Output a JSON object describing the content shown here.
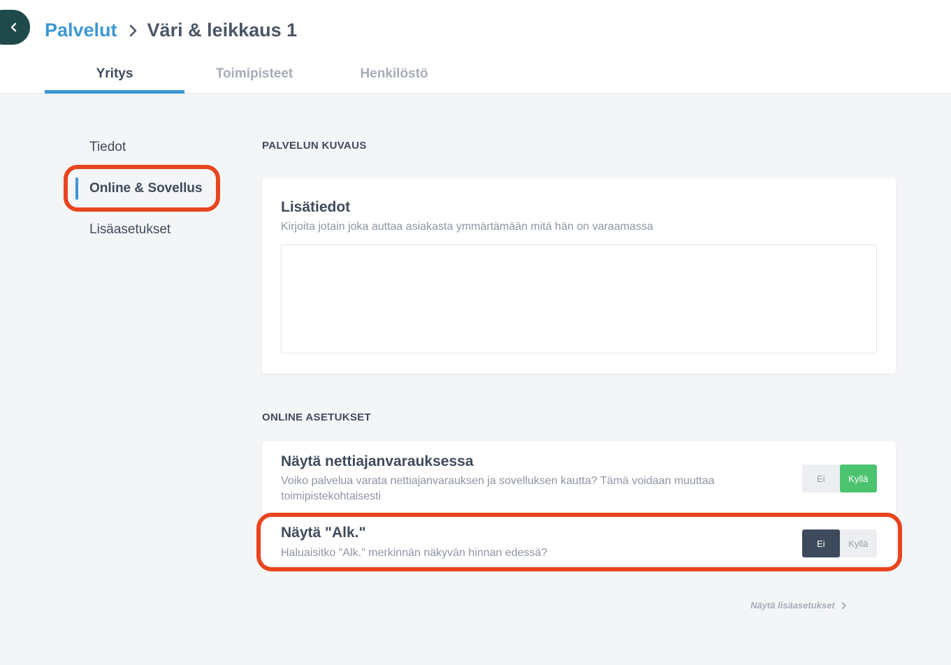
{
  "breadcrumb": {
    "parent": "Palvelut",
    "current": "Väri & leikkaus 1"
  },
  "tabs": [
    {
      "label": "Yritys",
      "active": true
    },
    {
      "label": "Toimipisteet",
      "active": false
    },
    {
      "label": "Henkilöstö",
      "active": false
    }
  ],
  "sidenav": {
    "items": [
      {
        "label": "Tiedot",
        "active": false
      },
      {
        "label": "Online & Sovellus",
        "active": true
      },
      {
        "label": "Lisäasetukset",
        "active": false
      }
    ]
  },
  "description_section": {
    "title": "PALVELUN KUVAUS",
    "field_title": "Lisätiedot",
    "field_help": "Kirjoita jotain joka auttaa asiakasta ymmärtämään mitä hän on varaamassa",
    "value": ""
  },
  "online_section": {
    "title": "ONLINE ASETUKSET",
    "settings": [
      {
        "title": "Näytä nettiajanvarauksessa",
        "help": "Voiko palvelua varata nettiajanvarauksen ja sovelluksen kautta? Tämä voidaan muuttaa toimipistekohtaisesti",
        "no_label": "Ei",
        "yes_label": "Kyllä",
        "selected": "Kyllä"
      },
      {
        "title": "Näytä \"Alk.\"",
        "help": "Haluaisitko \"Alk.\" merkinnän näkyvän hinnan edessä?",
        "no_label": "Ei",
        "yes_label": "Kyllä",
        "selected": "Ei"
      }
    ]
  },
  "more_settings_label": "Näytä lisäasetukset",
  "colors": {
    "accent": "#3c97d3",
    "highlight": "#e8451f",
    "toggle_yes": "#4cc46f",
    "toggle_no": "#3d4a5c",
    "back_button": "#1f4a4c"
  },
  "icons": {
    "back": "chevron-left-icon",
    "breadcrumb_separator": "chevron-right-icon",
    "more": "chevron-right-icon"
  }
}
